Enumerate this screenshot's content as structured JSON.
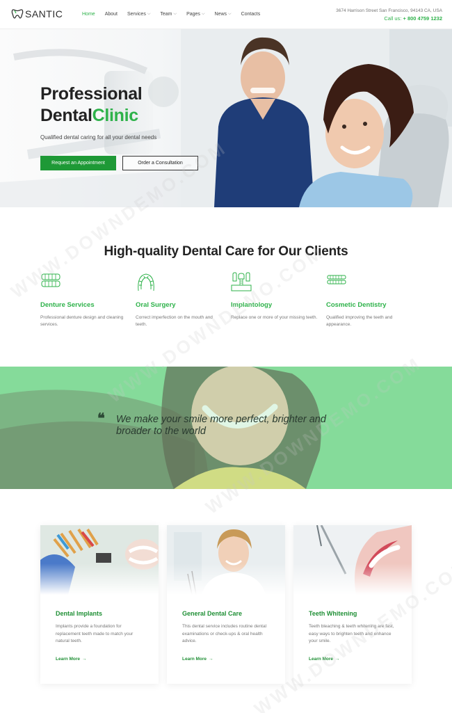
{
  "header": {
    "logo_text": "SANTIC",
    "nav": [
      {
        "label": "Home",
        "active": true,
        "dropdown": false
      },
      {
        "label": "About",
        "active": false,
        "dropdown": false
      },
      {
        "label": "Services",
        "active": false,
        "dropdown": true
      },
      {
        "label": "Team",
        "active": false,
        "dropdown": true
      },
      {
        "label": "Pages",
        "active": false,
        "dropdown": true
      },
      {
        "label": "News",
        "active": false,
        "dropdown": true
      },
      {
        "label": "Contacts",
        "active": false,
        "dropdown": false
      }
    ],
    "address": "3674 Harrison Street San Francisco, 94143 CA, USA",
    "call_label": "Call us:",
    "phone": "+ 800 4759 1232"
  },
  "hero": {
    "title_line1": "Professional",
    "title_line2_dark": "Dental",
    "title_line2_green": "Clinic",
    "subtitle": "Qualified dental caring for all your dental needs",
    "primary_button": "Request an Appointment",
    "secondary_button": "Order a Consultation"
  },
  "features": {
    "title": "High-quality Dental Care for Our Clients",
    "items": [
      {
        "icon": "denture-icon",
        "title": "Denture Services",
        "desc": "Professional denture design and cleaning services."
      },
      {
        "icon": "braces-icon",
        "title": "Oral Surgery",
        "desc": "Correct imperfection on the mouth and teeth."
      },
      {
        "icon": "implant-icon",
        "title": "Implantology",
        "desc": "Replace one or more of your missing teeth."
      },
      {
        "icon": "teeth-row-icon",
        "title": "Cosmetic Dentistry",
        "desc": "Qualified improving the teeth and appearance."
      }
    ]
  },
  "quote": {
    "mark": "❝",
    "text": "We make your smile more perfect, brighter and broader to the world"
  },
  "cards": [
    {
      "title": "Dental Implants",
      "desc": "Implants provide a foundation for replacement teeth made to match your natural teeth.",
      "link": "Learn More",
      "link_arrow": "→"
    },
    {
      "title": "General Dental Care",
      "desc": "This dental service includes routine dental examinations or check-ups & oral health advice.",
      "link": "Learn More",
      "link_arrow": "→"
    },
    {
      "title": "Teeth Whitening",
      "desc": "Teeth bleaching & teeth whitening are fast, easy ways to brighten teeth and enhance your smile.",
      "link": "Learn More",
      "link_arrow": "→"
    }
  ],
  "watermark": "WWW.DOWNDEMO.COM",
  "colors": {
    "accent": "#2eb24a",
    "button": "#1e9936",
    "band": "#73d58c",
    "text": "#222222"
  }
}
